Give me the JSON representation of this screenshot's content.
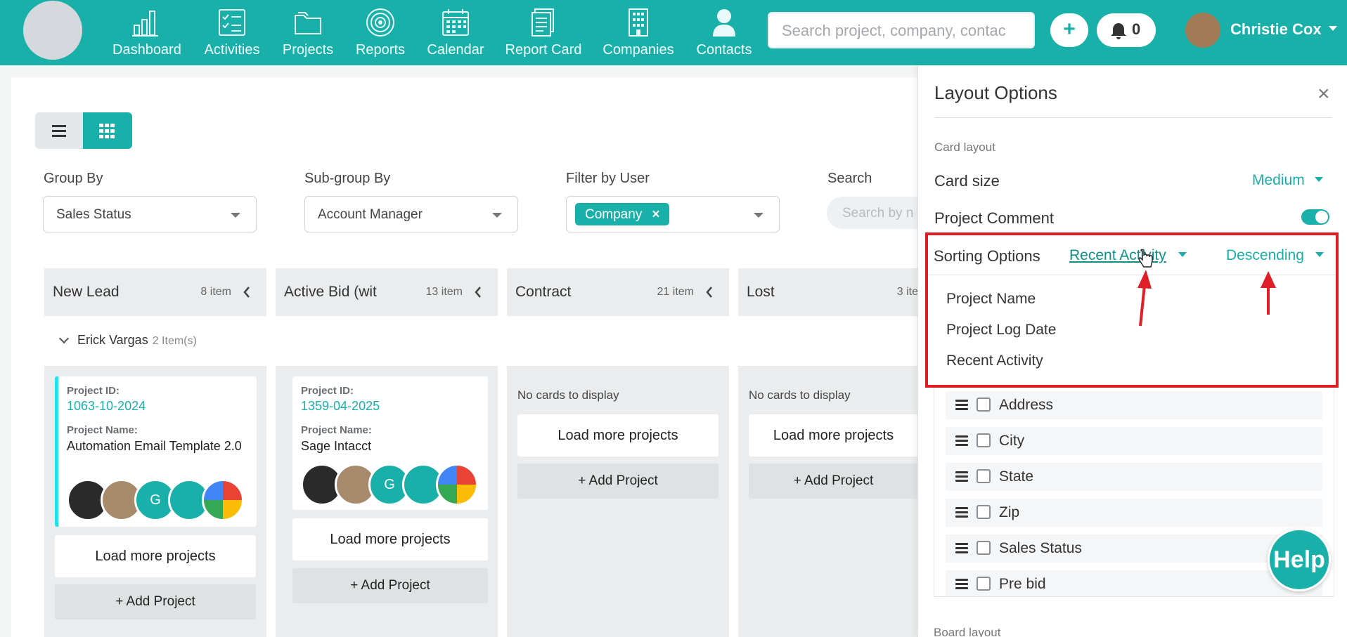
{
  "nav": {
    "items": [
      {
        "label": "Dashboard",
        "icon": "bar-chart-icon"
      },
      {
        "label": "Activities",
        "icon": "checklist-icon"
      },
      {
        "label": "Projects",
        "icon": "folder-icon"
      },
      {
        "label": "Reports",
        "icon": "target-icon"
      },
      {
        "label": "Calendar",
        "icon": "calendar-icon"
      },
      {
        "label": "Report Card",
        "icon": "document-icon"
      },
      {
        "label": "Companies",
        "icon": "building-icon"
      },
      {
        "label": "Contacts",
        "icon": "person-icon"
      }
    ],
    "search_placeholder": "Search project, company, contac",
    "add_label": "+",
    "notification_count": "0",
    "user_name": "Christie Cox"
  },
  "filters": {
    "group_by_label": "Group By",
    "group_by_value": "Sales Status",
    "subgroup_label": "Sub-group By",
    "subgroup_value": "Account Manager",
    "filter_user_label": "Filter by User",
    "filter_user_chip": "Company",
    "filter_user_chip_remove": "×",
    "search_label": "Search",
    "search_placeholder": "Search by n"
  },
  "columns": [
    {
      "title": "New Lead",
      "count": "8 item"
    },
    {
      "title": "Active Bid (wit",
      "count": "13 item"
    },
    {
      "title": "Contract",
      "count": "21 item"
    },
    {
      "title": "Lost",
      "count": "3 ite"
    }
  ],
  "group": {
    "name": "Erick Vargas",
    "count": "2 Item(s)"
  },
  "cards": [
    {
      "id_label": "Project ID:",
      "id": "1063-10-2024",
      "name_label": "Project Name:",
      "name": "Automation Email Template 2.0",
      "avatar_letter": "G"
    },
    {
      "id_label": "Project ID:",
      "id": "1359-04-2025",
      "name_label": "Project Name:",
      "name": "Sage Intacct",
      "avatar_letter": "G"
    }
  ],
  "board": {
    "no_cards": "No cards to display",
    "load_more": "Load more projects",
    "add_project": "+ Add Project"
  },
  "panel": {
    "title": "Layout Options",
    "close": "×",
    "card_layout_heading": "Card layout",
    "card_size_label": "Card size",
    "card_size_value": "Medium",
    "project_comment_label": "Project Comment",
    "project_comment_enabled": true,
    "sorting_label": "Sorting Options",
    "sort_field": "Recent Activity",
    "sort_order": "Descending",
    "sort_menu": [
      "Project Name",
      "Project Log Date",
      "Recent Activity"
    ],
    "fields": [
      "Address",
      "City",
      "State",
      "Zip",
      "Sales Status",
      "Pre bid"
    ],
    "board_layout_heading": "Board layout",
    "help": "Help"
  },
  "colors": {
    "brand": "#1ab0aa",
    "annotation_red": "#e01e26",
    "card_accent": "#22e3ea"
  }
}
